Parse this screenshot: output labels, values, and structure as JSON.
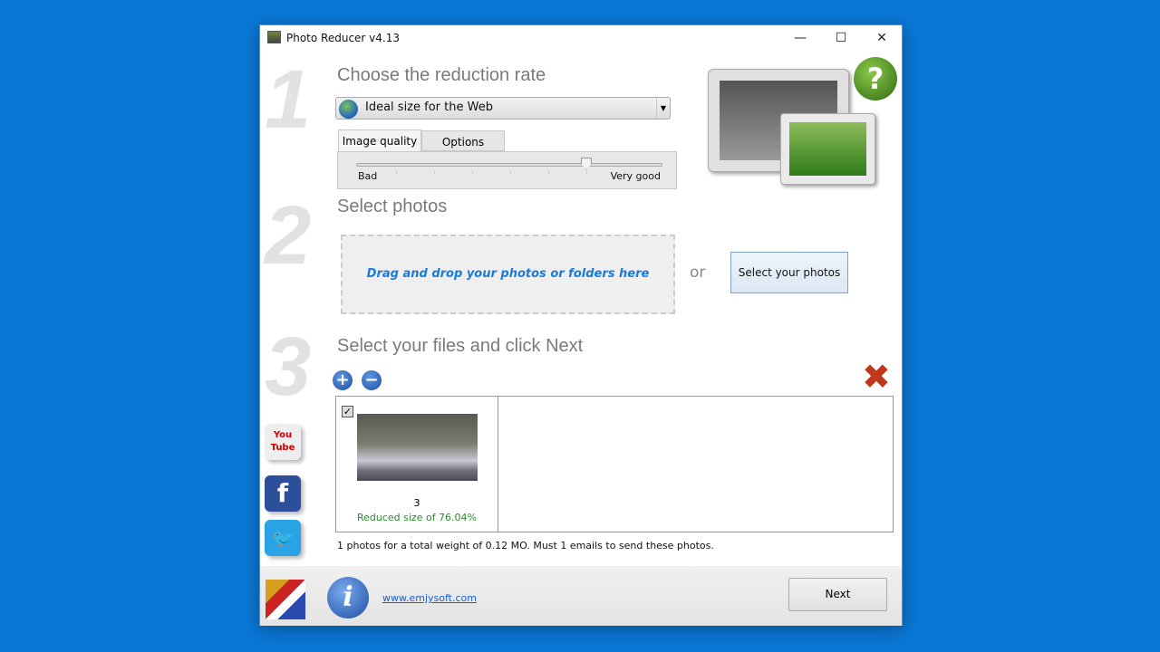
{
  "window": {
    "title": "Photo Reducer v4.13",
    "minimize": "—",
    "maximize": "☐",
    "close": "✕"
  },
  "steps": {
    "n1": "1",
    "n2": "2",
    "n3": "3"
  },
  "step1": {
    "heading": "Choose the reduction rate",
    "preset": "Ideal size for the Web",
    "tabs": [
      "Image quality",
      "Options"
    ],
    "active_tab": "Image quality",
    "slider": {
      "min_label": "Bad",
      "max_label": "Very good",
      "value_fraction": 0.75,
      "ticks": 8
    }
  },
  "step2": {
    "heading": "Select photos",
    "drop_text": "Drag and drop your photos or folders here",
    "or": "or",
    "select_button": "Select your photos"
  },
  "step3": {
    "heading": "Select your files and click Next",
    "add": "+",
    "remove": "−",
    "clear": "✖",
    "files": [
      {
        "checked": true,
        "name": "3",
        "status": "Reduced size of 76.04%"
      }
    ],
    "summary": "1 photos for a total weight of 0.12 MO. Must 1 emails to send these photos."
  },
  "social": {
    "youtube": "You Tube",
    "facebook": "f",
    "twitter": "🐦"
  },
  "help": "?",
  "footer": {
    "info": "i",
    "link": "www.emjysoft.com",
    "next": "Next"
  }
}
